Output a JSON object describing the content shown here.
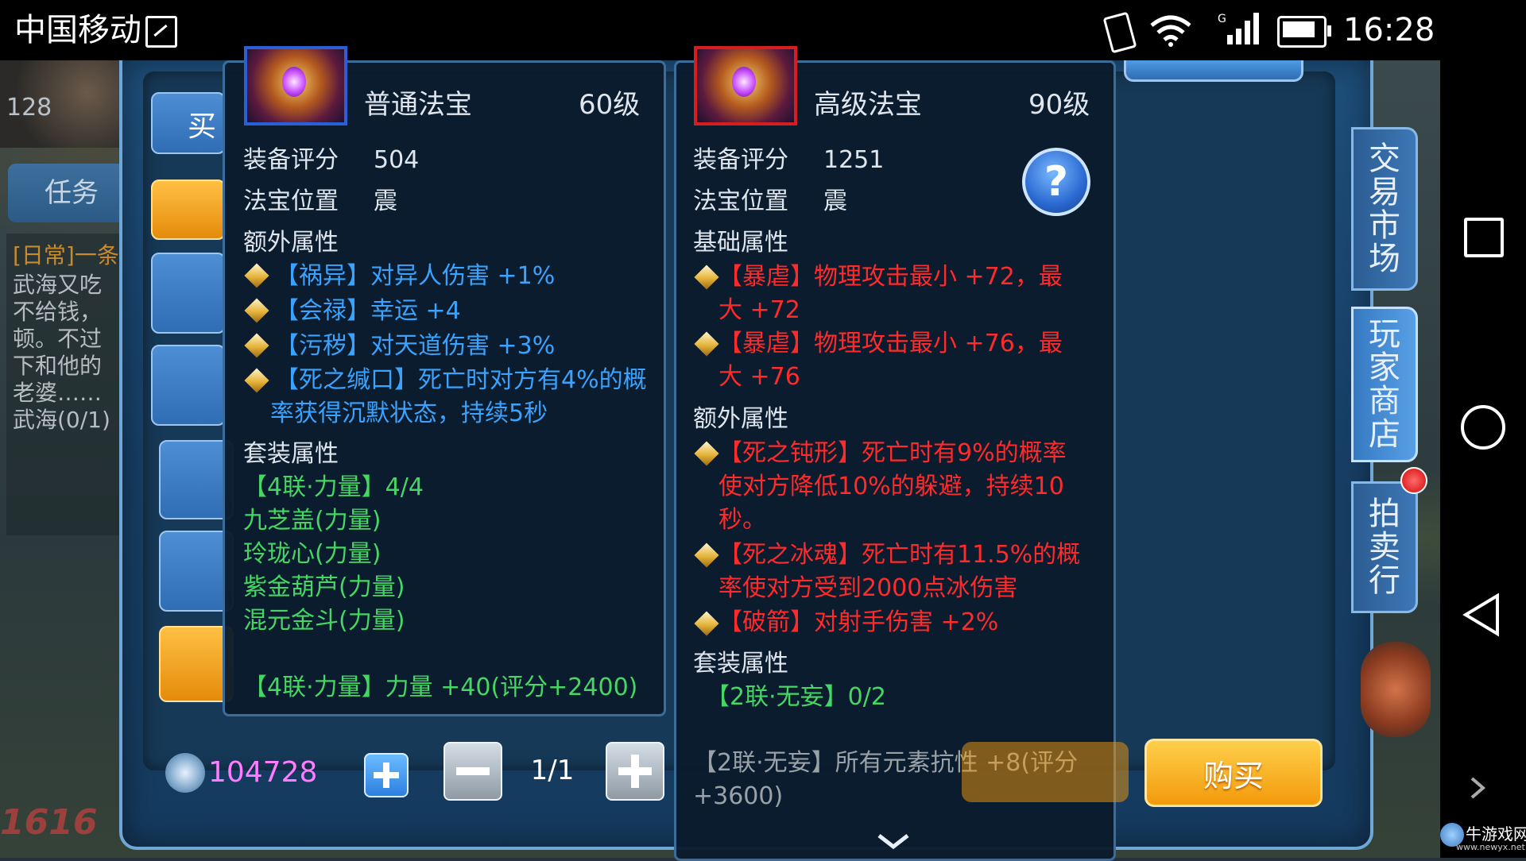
{
  "status_bar": {
    "carrier": "中国移动",
    "time": "16:28"
  },
  "hud": {
    "level": "128",
    "task_tab": "任务",
    "quest_title": "[日常]一条",
    "quest_lines": [
      "武海又吃",
      "不给钱，",
      "顿。不过",
      "下和他的",
      "老婆……",
      "武海(0/1)"
    ]
  },
  "shop": {
    "buy_tab": "买",
    "right_tabs": [
      {
        "label": "交易市场"
      },
      {
        "label": "玩家商店"
      },
      {
        "label": "拍卖行"
      }
    ],
    "currency_amount": "104728",
    "quantity": "1/1",
    "buy_button": "购买"
  },
  "left_item": {
    "grade": "普通法宝",
    "level": "60级",
    "score_label": "装备评分",
    "score": "504",
    "position_label": "法宝位置",
    "position": "震",
    "extra_header": "额外属性",
    "extra_attrs": [
      "【祸异】对异人伤害 +1%",
      "【会禄】幸运 +4",
      "【污秽】对天道伤害 +3%",
      "【死之缄口】死亡时对方有4%的概率获得沉默状态，持续5秒"
    ],
    "set_header": "套装属性",
    "set_name": "【4联·力量】4/4",
    "set_items": [
      "九芝盖(力量)",
      "玲珑心(力量)",
      "紫金葫芦(力量)",
      "混元金斗(力量)"
    ],
    "set_bonus": "【4联·力量】力量 +40(评分+2400)",
    "icon_border": "#2a5fd6"
  },
  "right_item": {
    "grade": "高级法宝",
    "level": "90级",
    "score_label": "装备评分",
    "score": "1251",
    "position_label": "法宝位置",
    "position": "震",
    "base_header": "基础属性",
    "base_attrs": [
      "【暴虐】物理攻击最小 +72，最大 +72",
      "【暴虐】物理攻击最小 +76，最大 +76"
    ],
    "extra_header": "额外属性",
    "extra_attrs": [
      "【死之钝形】死亡时有9%的概率使对方降低10%的躲避，持续10秒。",
      "【死之冰魂】死亡时有11.5%的概率使对方受到2000点冰伤害",
      "【破箭】对射手伤害 +2%"
    ],
    "set_header": "套装属性",
    "set_name": "【2联·无妄】0/2",
    "set_bonus": "【2联·无妄】所有元素抗性 +8(评分+3600)",
    "icon_border": "#d61e1e",
    "help_icon": "?"
  },
  "watermark": {
    "brand": "牛游戏网",
    "url": "www.newyx.net"
  },
  "colors": {
    "blue_attr": "#3aa3ff",
    "green_attr": "#45d663",
    "red_attr": "#ff2a2a",
    "gold": "#f39a0c"
  }
}
